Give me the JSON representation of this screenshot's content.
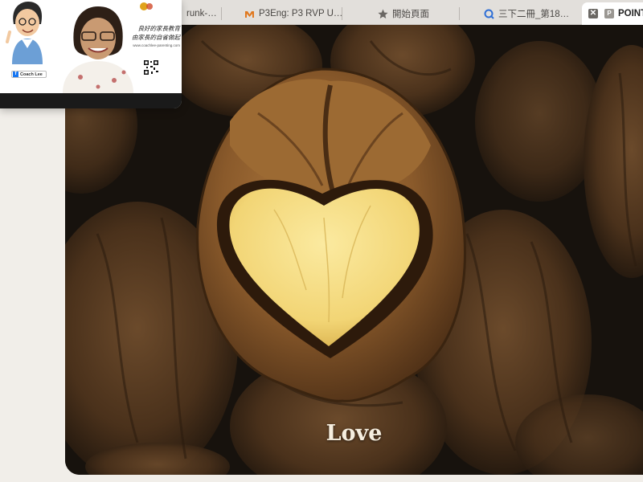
{
  "browser": {
    "tabs": [
      {
        "label": "runk-…",
        "icon": "tab-favicon",
        "active": false
      },
      {
        "label": "P3Eng: P3 RVP U…",
        "icon": "m-favicon",
        "active": false
      },
      {
        "label": "開始頁面",
        "icon": "star-icon",
        "active": false
      },
      {
        "label": "三下二冊_第18…",
        "icon": "q-favicon",
        "active": false
      },
      {
        "label": "POINTS",
        "icon": "p-favicon",
        "active": true
      }
    ],
    "close_glyph": "✕",
    "p_glyph": "P"
  },
  "video": {
    "fb_label": "Coach Lee",
    "fb_glyph": "f",
    "slogan": [
      "良好的家長教育",
      "由家長的自省做起"
    ],
    "url": "www.coachlee-parenting.com"
  },
  "slide": {
    "caption": "Love",
    "colors": {
      "background": "#17120d",
      "shell": "#8a5a2b",
      "kernel": "#f5df86",
      "caption": "#f6eedf"
    }
  }
}
